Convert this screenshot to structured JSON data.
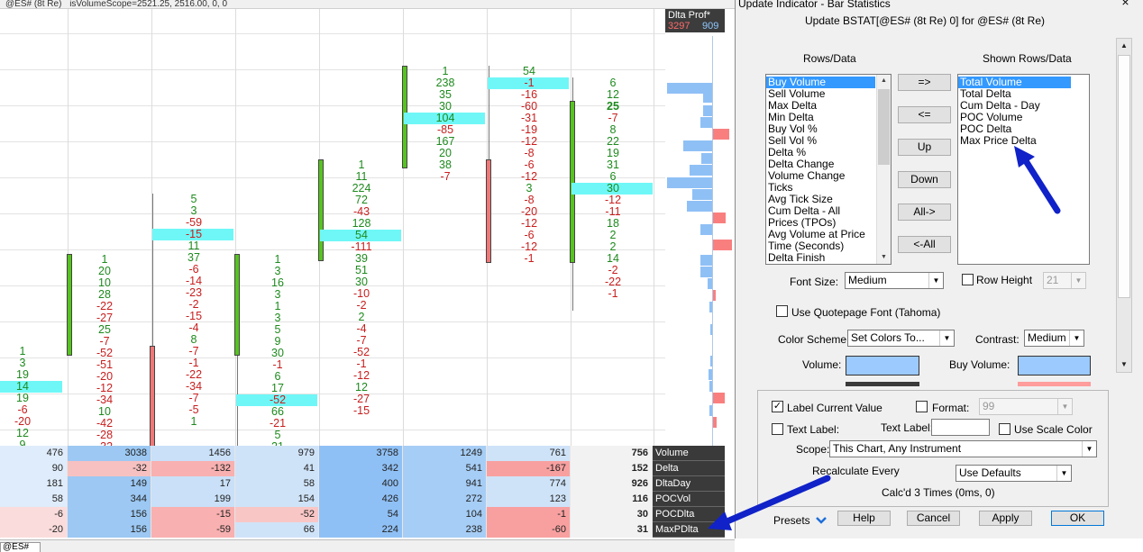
{
  "chart": {
    "topbar": {
      "symbol": "@ES# (8t Re)",
      "study": "isVolumeScope=2521.25, 2516.00, 0, 0"
    },
    "profile": {
      "title": "Dlta Prof*",
      "val_left": "3297",
      "val_right": "909"
    },
    "columns": [
      {
        "rows": [
          [
            "1",
            "pos"
          ],
          [
            "3",
            "pos"
          ],
          [
            "19",
            "pos"
          ],
          [
            "14",
            "pos"
          ],
          [
            "19",
            "pos"
          ],
          [
            "-6",
            "neg"
          ],
          [
            "-20",
            "neg"
          ],
          [
            "12",
            "pos"
          ],
          [
            "9",
            "pos"
          ]
        ]
      },
      {
        "rows": [
          [
            "1",
            "pos"
          ],
          [
            "20",
            "pos"
          ],
          [
            "10",
            "pos"
          ],
          [
            "28",
            "pos"
          ],
          [
            "-22",
            "neg"
          ],
          [
            "-27",
            "neg"
          ],
          [
            "25",
            "pos"
          ],
          [
            "-7",
            "neg"
          ],
          [
            "-52",
            "neg"
          ],
          [
            "-51",
            "neg"
          ],
          [
            "-20",
            "neg"
          ],
          [
            "-12",
            "neg"
          ],
          [
            "-34",
            "neg"
          ],
          [
            "10",
            "pos"
          ],
          [
            "-42",
            "neg"
          ],
          [
            "-28",
            "neg"
          ],
          [
            "-32",
            "neg"
          ]
        ]
      },
      {
        "rows": [
          [
            "5",
            "pos"
          ],
          [
            "3",
            "pos"
          ],
          [
            "-59",
            "neg"
          ],
          [
            "-15",
            "neg"
          ],
          [
            "11",
            "pos"
          ],
          [
            "37",
            "pos"
          ],
          [
            "-6",
            "neg"
          ],
          [
            "-14",
            "neg"
          ],
          [
            "-23",
            "neg"
          ],
          [
            "-2",
            "neg"
          ],
          [
            "-15",
            "neg"
          ],
          [
            "-4",
            "neg"
          ],
          [
            "8",
            "pos"
          ],
          [
            "-7",
            "neg"
          ],
          [
            "-1",
            "neg"
          ],
          [
            "-22",
            "neg"
          ],
          [
            "-34",
            "neg"
          ],
          [
            "-7",
            "neg"
          ],
          [
            "-5",
            "neg"
          ],
          [
            "1",
            "pos"
          ]
        ]
      },
      {
        "rows": [
          [
            "1",
            "pos"
          ],
          [
            "3",
            "pos"
          ],
          [
            "16",
            "pos"
          ],
          [
            "3",
            "pos"
          ],
          [
            "1",
            "pos"
          ],
          [
            "3",
            "pos"
          ],
          [
            "5",
            "pos"
          ],
          [
            "9",
            "pos"
          ],
          [
            "30",
            "pos"
          ],
          [
            "-1",
            "neg"
          ],
          [
            "6",
            "pos"
          ],
          [
            "17",
            "pos"
          ],
          [
            "-52",
            "neg"
          ],
          [
            "66",
            "pos"
          ],
          [
            "-21",
            "neg"
          ],
          [
            "5",
            "pos"
          ],
          [
            "21",
            "pos"
          ]
        ]
      },
      {
        "rows": [
          [
            "1",
            "pos"
          ],
          [
            "11",
            "pos"
          ],
          [
            "224",
            "pos"
          ],
          [
            "72",
            "pos"
          ],
          [
            "-43",
            "neg"
          ],
          [
            "128",
            "pos"
          ],
          [
            "54",
            "pos"
          ],
          [
            "-111",
            "neg"
          ],
          [
            "39",
            "pos"
          ],
          [
            "51",
            "pos"
          ],
          [
            "30",
            "pos"
          ],
          [
            "-10",
            "neg"
          ],
          [
            "-2",
            "neg"
          ],
          [
            "2",
            "pos"
          ],
          [
            "-4",
            "neg"
          ],
          [
            "-7",
            "neg"
          ],
          [
            "-52",
            "neg"
          ],
          [
            "-1",
            "neg"
          ],
          [
            "-12",
            "neg"
          ],
          [
            "12",
            "pos"
          ],
          [
            "-27",
            "neg"
          ],
          [
            "-15",
            "neg"
          ]
        ]
      },
      {
        "rows": [
          [
            "1",
            "pos"
          ],
          [
            "238",
            "pos"
          ],
          [
            "35",
            "pos"
          ],
          [
            "30",
            "pos"
          ],
          [
            "104",
            "pos"
          ],
          [
            "-85",
            "neg"
          ],
          [
            "167",
            "pos"
          ],
          [
            "20",
            "pos"
          ],
          [
            "38",
            "pos"
          ],
          [
            "-7",
            "neg"
          ]
        ]
      },
      {
        "rows": [
          [
            "54",
            "pos"
          ],
          [
            "-1",
            "neg"
          ],
          [
            "-16",
            "neg"
          ],
          [
            "-60",
            "neg"
          ],
          [
            "-31",
            "neg"
          ],
          [
            "-19",
            "neg"
          ],
          [
            "-12",
            "neg"
          ],
          [
            "-8",
            "neg"
          ],
          [
            "-6",
            "neg"
          ],
          [
            "-12",
            "neg"
          ],
          [
            "3",
            "pos"
          ],
          [
            "-8",
            "neg"
          ],
          [
            "-20",
            "neg"
          ],
          [
            "-12",
            "neg"
          ],
          [
            "-6",
            "neg"
          ],
          [
            "-12",
            "neg"
          ],
          [
            "-1",
            "neg"
          ]
        ]
      },
      {
        "rows": [
          [
            "6",
            "pos"
          ],
          [
            "12",
            "pos"
          ],
          [
            "25",
            "pos"
          ],
          [
            "-7",
            "neg"
          ],
          [
            "8",
            "pos"
          ],
          [
            "22",
            "pos"
          ],
          [
            "19",
            "pos"
          ],
          [
            "31",
            "pos"
          ],
          [
            "6",
            "pos"
          ],
          [
            "30",
            "pos"
          ],
          [
            "-12",
            "neg"
          ],
          [
            "-11",
            "neg"
          ],
          [
            "18",
            "pos"
          ],
          [
            "2",
            "pos"
          ],
          [
            "2",
            "pos"
          ],
          [
            "14",
            "pos"
          ],
          [
            "-2",
            "neg"
          ],
          [
            "-22",
            "neg"
          ],
          [
            "-1",
            "neg"
          ]
        ]
      }
    ],
    "table": {
      "rows": [
        {
          "label": "Volume",
          "values": [
            "476",
            "3038",
            "1456",
            "979",
            "3758",
            "1249",
            "761",
            "756"
          ]
        },
        {
          "label": "Delta",
          "values": [
            "90",
            "-32",
            "-132",
            "41",
            "342",
            "541",
            "-167",
            "152"
          ]
        },
        {
          "label": "DltaDay",
          "values": [
            "181",
            "149",
            "17",
            "58",
            "400",
            "941",
            "774",
            "926"
          ]
        },
        {
          "label": "POCVol",
          "values": [
            "58",
            "344",
            "199",
            "154",
            "426",
            "272",
            "123",
            "116"
          ]
        },
        {
          "label": "POCDlta",
          "values": [
            "-6",
            "156",
            "-15",
            "-52",
            "54",
            "104",
            "-1",
            "30"
          ]
        },
        {
          "label": "MaxPDlta",
          "values": [
            "-20",
            "156",
            "-59",
            "66",
            "224",
            "238",
            "-60",
            "31"
          ]
        }
      ]
    },
    "bottom": {
      "symbol": "@ES#"
    }
  },
  "dialog": {
    "title": "Update Indicator - Bar Statistics",
    "subtitle": "Update BSTAT[@ES# (8t Re) 0] for @ES# (8t Re)",
    "rows_label": "Rows/Data",
    "shown_label": "Shown Rows/Data",
    "available_items": [
      "Buy Volume",
      "Sell Volume",
      "Max Delta",
      "Min Delta",
      "Buy Vol %",
      "Sell Vol %",
      "Delta %",
      "Delta Change",
      "Volume Change",
      "Ticks",
      "Avg Tick Size",
      "Cum Delta - All",
      "Prices (TPOs)",
      "Avg Volume at Price",
      "Time (Seconds)",
      "Delta Finish"
    ],
    "shown_items": [
      "Total Volume",
      "Total Delta",
      "Cum Delta - Day",
      "POC Volume",
      "POC Delta",
      "Max Price Delta"
    ],
    "buttons": {
      "add": "=>",
      "remove": "<=",
      "up": "Up",
      "down": "Down",
      "all_add": "All->",
      "all_remove": "<-All"
    },
    "font_size_label": "Font Size:",
    "font_size_value": "Medium",
    "row_height_label": "Row Height",
    "row_height_value": "21",
    "quotepage_font_label": "Use Quotepage Font (Tahoma)",
    "color_scheme_label": "Color Scheme:",
    "color_scheme_value": "Set Colors To...",
    "contrast_label": "Contrast:",
    "contrast_value": "Medium",
    "volume_label": "Volume:",
    "buy_volume_label": "Buy Volume:",
    "colors": {
      "volume": "#9ccaff",
      "buy_volume": "#9ccaff",
      "pos": "#1e8a1e",
      "neg": "#c81e1e",
      "poc": "#6ff7f7"
    },
    "label_current_value": "Label Current Value",
    "format_label": "Format:",
    "format_value": "99",
    "text_label_chk": "Text Label:",
    "text_label_field": "Text Label:",
    "text_label_value": "",
    "use_scale_color": "Use Scale Color",
    "scope_label": "Scope:",
    "scope_value": "This Chart, Any Instrument",
    "recalc_label": "Recalculate Every",
    "recalc_value": "Use Defaults",
    "calcd": "Calc'd 3 Times (0ms, 0)",
    "presets": "Presets",
    "help": "Help",
    "cancel": "Cancel",
    "apply": "Apply",
    "ok": "OK"
  }
}
